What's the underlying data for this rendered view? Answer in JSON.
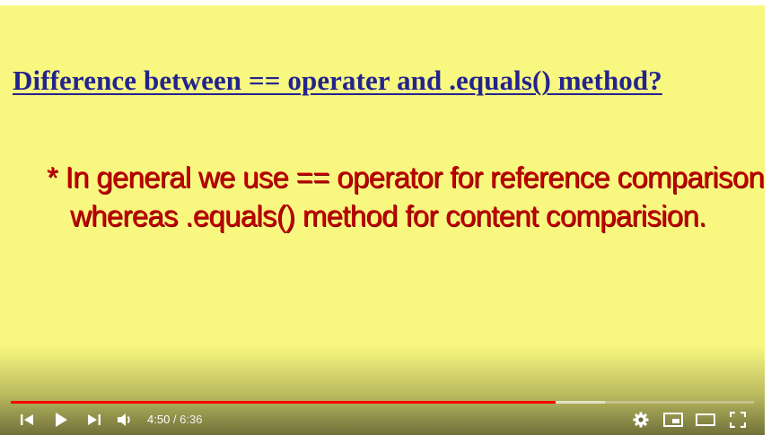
{
  "slide": {
    "title": "Difference between == operater and .equals() method?",
    "bullet_line1": "* In general we use == operator for reference comparison,",
    "bullet_line2": "whereas .equals() method for content comparision."
  },
  "player": {
    "current_time": "4:50",
    "separator": " / ",
    "duration": "6:36",
    "played_fraction": 0.733,
    "buffered_fraction": 0.8,
    "colors": {
      "slide_background": "#f8f880",
      "title": "#23238e",
      "bullet": "#c00000",
      "progress": "#ff0000"
    },
    "icons": [
      "previous-icon",
      "play-icon",
      "next-icon",
      "volume-icon",
      "settings-icon",
      "miniplayer-icon",
      "theater-mode-icon",
      "fullscreen-icon"
    ]
  }
}
